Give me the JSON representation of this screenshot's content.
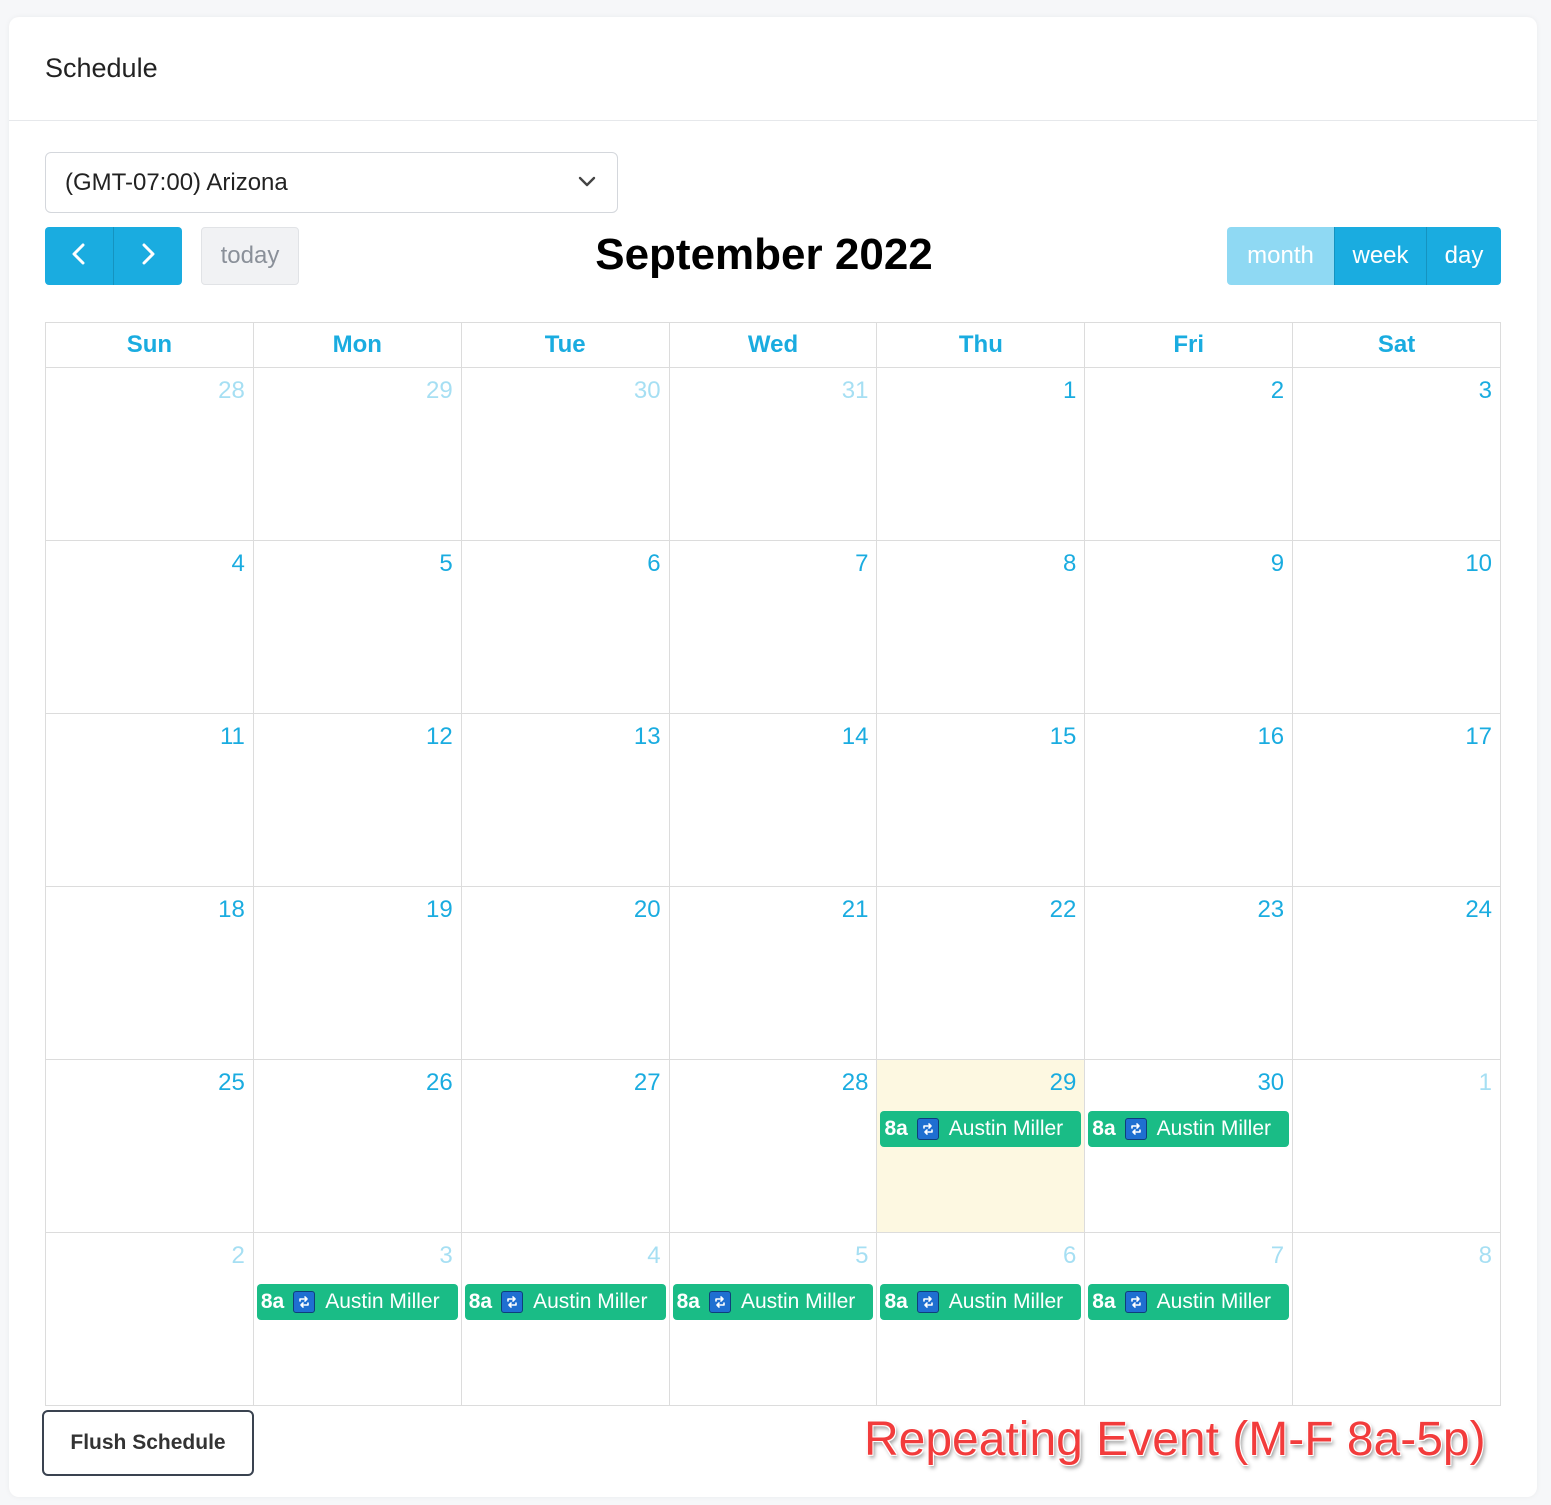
{
  "card": {
    "title": "Schedule"
  },
  "timezone": {
    "selected": "(GMT-07:00) Arizona"
  },
  "toolbar": {
    "prev_icon": "chevron-left-icon",
    "next_icon": "chevron-right-icon",
    "today_label": "today",
    "title": "September 2022",
    "views": [
      {
        "label": "month",
        "active": true
      },
      {
        "label": "week",
        "active": false
      },
      {
        "label": "day",
        "active": false
      }
    ]
  },
  "calendar": {
    "days_of_week": [
      "Sun",
      "Mon",
      "Tue",
      "Wed",
      "Thu",
      "Fri",
      "Sat"
    ],
    "weeks": [
      [
        {
          "num": "28",
          "other": true
        },
        {
          "num": "29",
          "other": true
        },
        {
          "num": "30",
          "other": true
        },
        {
          "num": "31",
          "other": true
        },
        {
          "num": "1"
        },
        {
          "num": "2"
        },
        {
          "num": "3"
        }
      ],
      [
        {
          "num": "4"
        },
        {
          "num": "5"
        },
        {
          "num": "6"
        },
        {
          "num": "7"
        },
        {
          "num": "8"
        },
        {
          "num": "9"
        },
        {
          "num": "10"
        }
      ],
      [
        {
          "num": "11"
        },
        {
          "num": "12"
        },
        {
          "num": "13"
        },
        {
          "num": "14"
        },
        {
          "num": "15"
        },
        {
          "num": "16"
        },
        {
          "num": "17"
        }
      ],
      [
        {
          "num": "18"
        },
        {
          "num": "19"
        },
        {
          "num": "20"
        },
        {
          "num": "21"
        },
        {
          "num": "22"
        },
        {
          "num": "23"
        },
        {
          "num": "24"
        }
      ],
      [
        {
          "num": "25"
        },
        {
          "num": "26"
        },
        {
          "num": "27"
        },
        {
          "num": "28"
        },
        {
          "num": "29",
          "today": true,
          "event": {
            "time": "8a",
            "title": "Austin Miller"
          }
        },
        {
          "num": "30",
          "event": {
            "time": "8a",
            "title": "Austin Miller"
          }
        },
        {
          "num": "1",
          "other": true
        }
      ],
      [
        {
          "num": "2",
          "other": true
        },
        {
          "num": "3",
          "other": true,
          "event": {
            "time": "8a",
            "title": "Austin Miller"
          }
        },
        {
          "num": "4",
          "other": true,
          "event": {
            "time": "8a",
            "title": "Austin Miller"
          }
        },
        {
          "num": "5",
          "other": true,
          "event": {
            "time": "8a",
            "title": "Austin Miller"
          }
        },
        {
          "num": "6",
          "other": true,
          "event": {
            "time": "8a",
            "title": "Austin Miller"
          }
        },
        {
          "num": "7",
          "other": true,
          "event": {
            "time": "8a",
            "title": "Austin Miller"
          }
        },
        {
          "num": "8",
          "other": true
        }
      ]
    ],
    "event_icon": "repeat-icon",
    "colors": {
      "accent": "#1aace0",
      "event": "#1abc86",
      "today_bg": "#fdf8e1",
      "other_month": "#a6dff3"
    }
  },
  "footer": {
    "flush_label": "Flush Schedule",
    "annotation": "Repeating Event (M-F 8a-5p)"
  }
}
